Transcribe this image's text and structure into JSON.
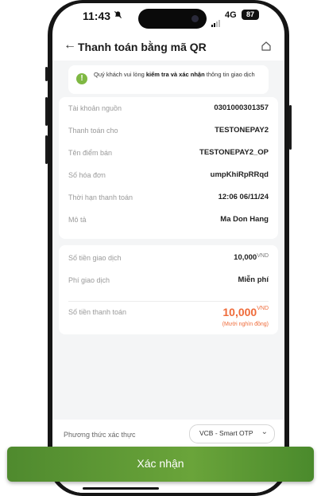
{
  "status_bar": {
    "time": "11:43",
    "notification_icon": "bell-off-icon",
    "network": "4G",
    "battery": "87"
  },
  "header": {
    "back_icon": "arrow-left-icon",
    "title": "Thanh toán bằng mã QR",
    "home_icon": "home-icon"
  },
  "notice": {
    "icon": "info-icon",
    "prefix": "Quý khách vui lòng ",
    "emphasis": "kiểm tra và xác nhận",
    "suffix": " thông tin giao dịch"
  },
  "details": [
    {
      "label": "Tài khoản nguồn",
      "value": "0301000301357"
    },
    {
      "label": "Thanh toán cho",
      "value": "TESTONEPAY2"
    },
    {
      "label": "Tên điểm bán",
      "value": "TESTONEPAY2_OP"
    },
    {
      "label": "Số hóa đơn",
      "value": "umpKhiRpRRqd"
    },
    {
      "label": "Thời hạn thanh toán",
      "value": "12:06 06/11/24"
    },
    {
      "label": "Mô tả",
      "value": "Ma Don Hang"
    }
  ],
  "amounts": {
    "amount_label": "Số tiền giao dịch",
    "amount_value": "10,000",
    "currency": "VND",
    "fee_label": "Phí giao dịch",
    "fee_value": "Miễn phí",
    "total_label": "Số tiền thanh toán",
    "total_value": "10,000",
    "total_words": "(Mười nghìn đồng)"
  },
  "auth": {
    "label": "Phương thức xác thực",
    "selected": "VCB - Smart OTP",
    "chevron_icon": "chevron-down-icon"
  },
  "confirm_label": "Xác nhận",
  "colors": {
    "accent_green": "#5a9a34",
    "total_orange": "#ef6b3a",
    "info_green": "#7fb843"
  }
}
